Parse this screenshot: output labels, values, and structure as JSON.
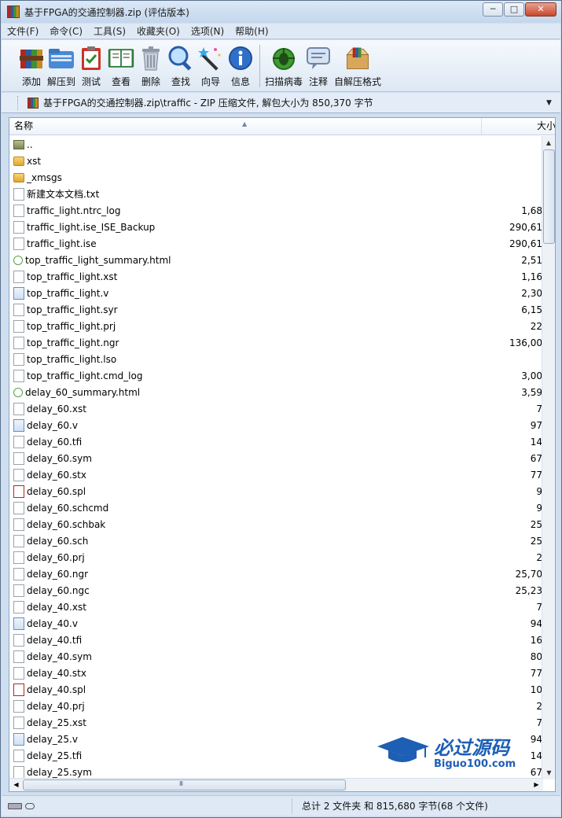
{
  "window": {
    "title": "基于FPGA的交通控制器.zip (评估版本)",
    "minimize": "─",
    "maximize": "□",
    "close": "✕"
  },
  "menu": [
    "文件(F)",
    "命令(C)",
    "工具(S)",
    "收藏夹(O)",
    "选项(N)",
    "帮助(H)"
  ],
  "toolbar": [
    {
      "label": "添加",
      "icon": "archive-add-icon"
    },
    {
      "label": "解压到",
      "icon": "extract-folder-icon"
    },
    {
      "label": "测试",
      "icon": "test-clipboard-icon"
    },
    {
      "label": "查看",
      "icon": "view-book-icon"
    },
    {
      "label": "删除",
      "icon": "trash-icon"
    },
    {
      "label": "查找",
      "icon": "magnifier-icon"
    },
    {
      "label": "向导",
      "icon": "wizard-wand-icon"
    },
    {
      "label": "信息",
      "icon": "info-icon"
    },
    {
      "label": "扫描病毒",
      "icon": "virus-scan-icon"
    },
    {
      "label": "注释",
      "icon": "comment-icon"
    },
    {
      "label": "自解压格式",
      "icon": "sfx-box-icon"
    }
  ],
  "address": {
    "path": "基于FPGA的交通控制器.zip\\traffic - ZIP 压缩文件, 解包大小为 850,370 字节"
  },
  "columns": {
    "name": "名称",
    "size": "大小"
  },
  "files": [
    {
      "name": "..",
      "size": "",
      "type": "up"
    },
    {
      "name": "xst",
      "size": "",
      "type": "folder"
    },
    {
      "name": "_xmsgs",
      "size": "",
      "type": "folder"
    },
    {
      "name": "新建文本文档.txt",
      "size": "",
      "type": "file"
    },
    {
      "name": "traffic_light.ntrc_log",
      "size": "1,68",
      "type": "file"
    },
    {
      "name": "traffic_light.ise_ISE_Backup",
      "size": "290,61",
      "type": "file"
    },
    {
      "name": "traffic_light.ise",
      "size": "290,61",
      "type": "file"
    },
    {
      "name": "top_traffic_light_summary.html",
      "size": "2,51",
      "type": "html"
    },
    {
      "name": "top_traffic_light.xst",
      "size": "1,16",
      "type": "file"
    },
    {
      "name": "top_traffic_light.v",
      "size": "2,30",
      "type": "v"
    },
    {
      "name": "top_traffic_light.syr",
      "size": "6,15",
      "type": "file"
    },
    {
      "name": "top_traffic_light.prj",
      "size": "22",
      "type": "file"
    },
    {
      "name": "top_traffic_light.ngr",
      "size": "136,00",
      "type": "file"
    },
    {
      "name": "top_traffic_light.lso",
      "size": "",
      "type": "file"
    },
    {
      "name": "top_traffic_light.cmd_log",
      "size": "3,00",
      "type": "file"
    },
    {
      "name": "delay_60_summary.html",
      "size": "3,59",
      "type": "html"
    },
    {
      "name": "delay_60.xst",
      "size": "7",
      "type": "file"
    },
    {
      "name": "delay_60.v",
      "size": "97",
      "type": "v"
    },
    {
      "name": "delay_60.tfi",
      "size": "14",
      "type": "file"
    },
    {
      "name": "delay_60.sym",
      "size": "67",
      "type": "file"
    },
    {
      "name": "delay_60.stx",
      "size": "77",
      "type": "file"
    },
    {
      "name": "delay_60.spl",
      "size": "9",
      "type": "pdf"
    },
    {
      "name": "delay_60.schcmd",
      "size": "9",
      "type": "file"
    },
    {
      "name": "delay_60.schbak",
      "size": "25",
      "type": "file"
    },
    {
      "name": "delay_60.sch",
      "size": "25",
      "type": "file"
    },
    {
      "name": "delay_60.prj",
      "size": "2",
      "type": "file"
    },
    {
      "name": "delay_60.ngr",
      "size": "25,70",
      "type": "file"
    },
    {
      "name": "delay_60.ngc",
      "size": "25,23",
      "type": "file"
    },
    {
      "name": "delay_40.xst",
      "size": "7",
      "type": "file"
    },
    {
      "name": "delay_40.v",
      "size": "94",
      "type": "v"
    },
    {
      "name": "delay_40.tfi",
      "size": "16",
      "type": "file"
    },
    {
      "name": "delay_40.sym",
      "size": "80",
      "type": "file"
    },
    {
      "name": "delay_40.stx",
      "size": "77",
      "type": "file"
    },
    {
      "name": "delay_40.spl",
      "size": "10",
      "type": "pdf"
    },
    {
      "name": "delay_40.prj",
      "size": "2",
      "type": "file"
    },
    {
      "name": "delay_25.xst",
      "size": "7",
      "type": "file"
    },
    {
      "name": "delay_25.v",
      "size": "94",
      "type": "v"
    },
    {
      "name": "delay_25.tfi",
      "size": "14",
      "type": "file"
    },
    {
      "name": "delay_25.sym",
      "size": "67",
      "type": "file"
    }
  ],
  "status": {
    "summary": "总计 2 文件夹 和 815,680 字节(68 个文件)"
  },
  "watermark": {
    "cn": "必过源码",
    "en": "Biguo100.com"
  }
}
